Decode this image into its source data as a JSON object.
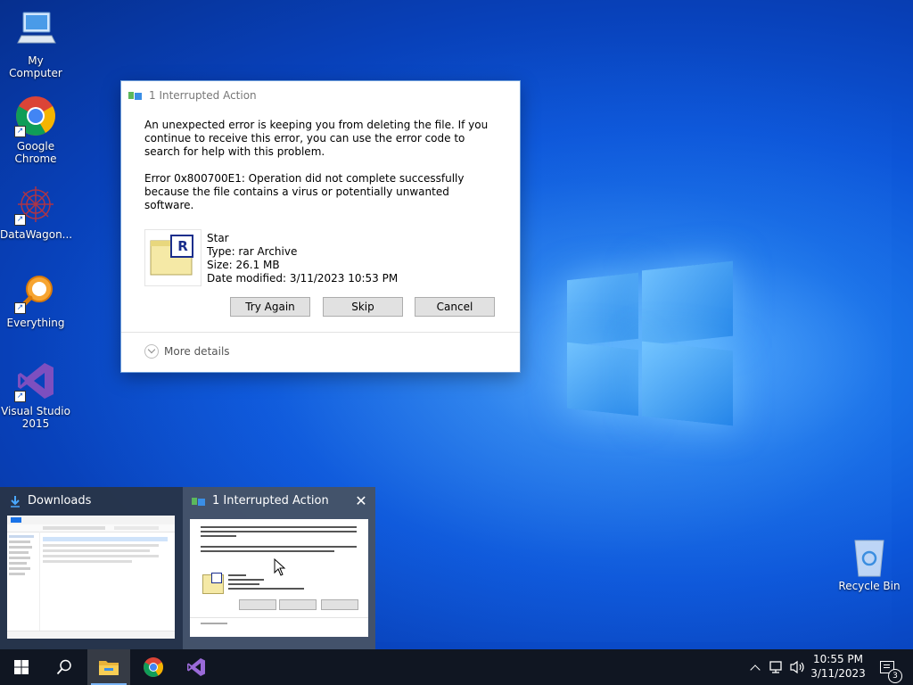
{
  "desktop": {
    "icons": [
      {
        "label": "My Computer"
      },
      {
        "label": "Google Chrome"
      },
      {
        "label": "DataWagon..."
      },
      {
        "label": "Everything"
      },
      {
        "label": "Visual Studio 2015"
      }
    ],
    "recycle_bin": "Recycle Bin"
  },
  "dialog": {
    "title": "1 Interrupted Action",
    "message": "An unexpected error is keeping you from deleting the file. If you continue to receive this error, you can use the error code to search for help with this problem.",
    "error": "Error 0x800700E1: Operation did not complete successfully because the file contains a virus or potentially unwanted software.",
    "file": {
      "name": "Star",
      "type": "Type: rar Archive",
      "size": "Size: 26.1 MB",
      "modified": "Date modified: 3/11/2023 10:53 PM",
      "icon_letter": "R"
    },
    "buttons": {
      "try_again": "Try Again",
      "skip": "Skip",
      "cancel": "Cancel"
    },
    "more_details": "More details"
  },
  "task_preview": {
    "downloads_title": "Downloads",
    "interrupted_title": "1 Interrupted Action",
    "close_glyph": "✕"
  },
  "taskbar": {
    "clock_time": "10:55 PM",
    "clock_date": "3/11/2023",
    "notification_count": "3"
  },
  "colors": {
    "desktop_blue": "#0c55d8",
    "taskbar": "#101622",
    "button_face": "#e1e1e1",
    "accent": "#7ab4f5"
  }
}
